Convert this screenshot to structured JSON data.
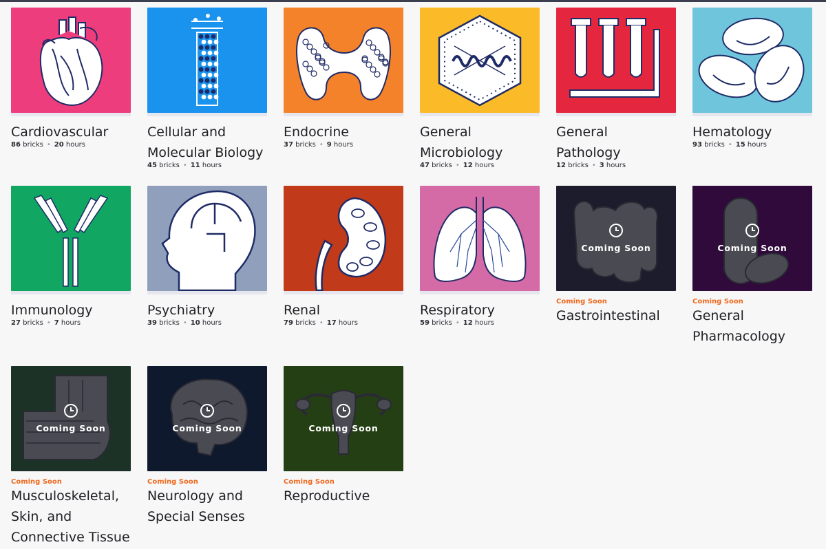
{
  "courses": [
    {
      "title": "Cardiovascular",
      "bricks": "86",
      "bricks_label": "bricks",
      "hours": "20",
      "hours_label": "hours",
      "color": "#ee3d7d",
      "icon": "heart-icon"
    },
    {
      "title": "Cellular and Molecular Biology",
      "bricks": "45",
      "bricks_label": "bricks",
      "hours": "11",
      "hours_label": "hours",
      "color": "#1a93ee",
      "icon": "dna-helix-icon"
    },
    {
      "title": "Endocrine",
      "bricks": "37",
      "bricks_label": "bricks",
      "hours": "9",
      "hours_label": "hours",
      "color": "#f3822a",
      "icon": "thyroid-icon"
    },
    {
      "title": "General Microbiology",
      "bricks": "47",
      "bricks_label": "bricks",
      "hours": "12",
      "hours_label": "hours",
      "color": "#fbbb29",
      "icon": "virus-icon"
    },
    {
      "title": "General Pathology",
      "bricks": "12",
      "bricks_label": "bricks",
      "hours": "3",
      "hours_label": "hours",
      "color": "#e4273f",
      "icon": "test-tubes-icon"
    },
    {
      "title": "Hematology",
      "bricks": "93",
      "bricks_label": "bricks",
      "hours": "15",
      "hours_label": "hours",
      "color": "#6fc6dc",
      "icon": "blood-cells-icon"
    },
    {
      "title": "Immunology",
      "bricks": "27",
      "bricks_label": "bricks",
      "hours": "7",
      "hours_label": "hours",
      "color": "#11a662",
      "icon": "antibody-icon"
    },
    {
      "title": "Psychiatry",
      "bricks": "39",
      "bricks_label": "bricks",
      "hours": "10",
      "hours_label": "hours",
      "color": "#8f9fbc",
      "icon": "head-puzzle-icon"
    },
    {
      "title": "Renal",
      "bricks": "79",
      "bricks_label": "bricks",
      "hours": "17",
      "hours_label": "hours",
      "color": "#c13a19",
      "icon": "kidney-icon"
    },
    {
      "title": "Respiratory",
      "bricks": "59",
      "bricks_label": "bricks",
      "hours": "12",
      "hours_label": "hours",
      "color": "#d46aa6",
      "icon": "lungs-icon"
    },
    {
      "title": "Gastrointestinal",
      "coming_soon": "Coming Soon",
      "color": "#1c1c2d",
      "icon": "intestines-icon"
    },
    {
      "title": "General Pharmacology",
      "coming_soon": "Coming Soon",
      "color": "#2f0a3b",
      "icon": "pills-icon"
    },
    {
      "title": "Musculoskeletal, Skin, and Connective Tissue",
      "coming_soon": "Coming Soon",
      "color": "#1d3227",
      "icon": "muscle-icon"
    },
    {
      "title": "Neurology and Special Senses",
      "coming_soon": "Coming Soon",
      "color": "#0f192d",
      "icon": "brain-icon"
    },
    {
      "title": "Reproductive",
      "coming_soon": "Coming Soon",
      "color": "#243f13",
      "icon": "uterus-icon"
    }
  ],
  "title_lines": {
    "c1": [
      "Cellular and",
      "Molecular Biology"
    ],
    "c3": [
      "General",
      "Microbiology"
    ],
    "c11": [
      "General",
      "Pharmacology"
    ],
    "c12": [
      "Musculoskeletal,",
      "Skin, and",
      "Connective Tissue"
    ],
    "c13": [
      "Neurology and",
      "Special Senses"
    ]
  },
  "overlay_label": "Coming Soon"
}
